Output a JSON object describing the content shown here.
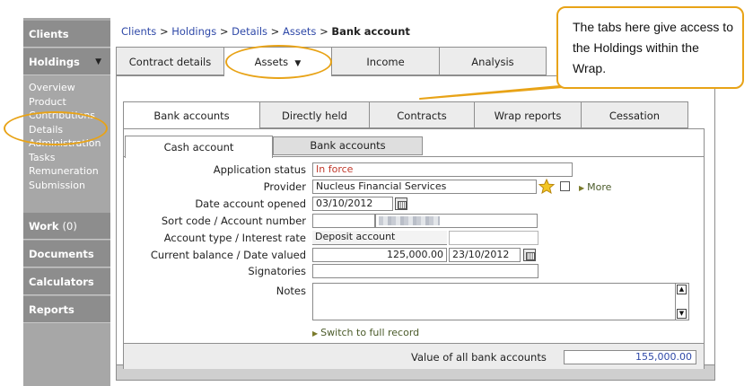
{
  "sidebar": {
    "clients": "Clients",
    "holdings": "Holdings",
    "holdings_arrow": "▼",
    "holdings_items": [
      "Overview",
      "Product",
      "Contributions",
      "Details",
      "Administration",
      "Tasks",
      "Remuneration",
      "Submission"
    ],
    "work": "Work",
    "work_count": "(0)",
    "documents": "Documents",
    "calculators": "Calculators",
    "reports": "Reports"
  },
  "breadcrumb": {
    "items": [
      "Clients",
      "Holdings",
      "Details",
      "Assets"
    ],
    "separator": " > ",
    "current": "Bank account"
  },
  "top_tabs": [
    "Contract details",
    "Assets",
    "Income",
    "Analysis"
  ],
  "top_tabs_arrow": "▼",
  "second_tabs": [
    "Bank accounts",
    "Directly held",
    "Contracts",
    "Wrap reports",
    "Cessation"
  ],
  "inner_tabs": [
    "Cash account",
    "Bank accounts"
  ],
  "form": {
    "application_status": {
      "label": "Application status",
      "value": "In force"
    },
    "provider": {
      "label": "Provider",
      "value": "Nucleus Financial Services",
      "more": "More"
    },
    "date_opened": {
      "label": "Date account opened",
      "value": "03/10/2012"
    },
    "sort_code": {
      "label": "Sort code / Account number",
      "value": "",
      "account_number": ""
    },
    "account_type": {
      "label": "Account type / Interest rate",
      "value": "Deposit account",
      "interest_rate": ""
    },
    "balance": {
      "label": "Current balance / Date valued",
      "value": "125,000.00",
      "date": "23/10/2012"
    },
    "signatories": {
      "label": "Signatories",
      "value": ""
    },
    "notes": {
      "label": "Notes",
      "value": ""
    },
    "switch_link": "Switch to full record"
  },
  "total": {
    "label": "Value of all bank accounts",
    "value": "155,000.00"
  },
  "callout": {
    "text": "The tabs here give access to the Holdings within the Wrap."
  },
  "colors": {
    "accent_orange": "#e8a317",
    "link_blue": "#2f49a8",
    "status_red": "#c0392b",
    "sidebar_grey": "#a7a7a7"
  }
}
